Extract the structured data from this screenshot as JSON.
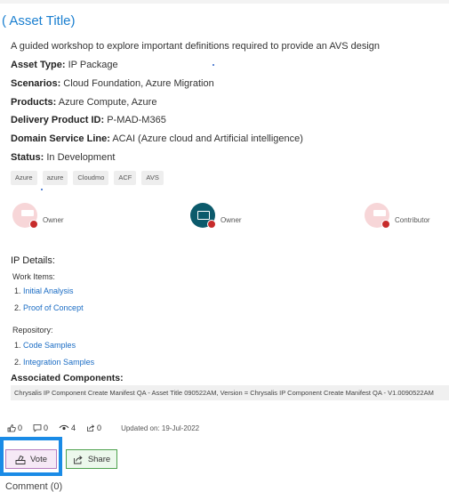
{
  "asset": {
    "title": "( Asset Title)",
    "description": "A guided workshop to explore important definitions required to provide an AVS design"
  },
  "fields": [
    {
      "label": "Asset Type:",
      "value": " IP Package"
    },
    {
      "label": "Scenarios:",
      "value": " Cloud Foundation, Azure Migration"
    },
    {
      "label": "Products:",
      "value": " Azure Compute, Azure"
    },
    {
      "label": "Delivery Product ID:",
      "value": " P-MAD-M365"
    },
    {
      "label": "Domain Service Line:",
      "value": " ACAI (Azure cloud and Artificial intelligence)"
    },
    {
      "label": "Status:",
      "value": " In Development"
    }
  ],
  "tags": [
    "Azure",
    "azure",
    "Cloudmo",
    "ACF",
    "AVS"
  ],
  "people": [
    {
      "name": "",
      "role": "Owner"
    },
    {
      "name": "",
      "role": "Owner"
    },
    {
      "name": "",
      "role": "Contributor"
    }
  ],
  "ip_details": {
    "heading": "IP Details:",
    "work_items_label": "Work Items:",
    "work_items": [
      {
        "num": "1.",
        "label": "Initial Analysis"
      },
      {
        "num": "2.",
        "label": "Proof of Concept"
      }
    ],
    "repository_label": "Repository:",
    "repository": [
      {
        "num": "1.",
        "label": "Code Samples"
      },
      {
        "num": "2.",
        "label": "Integration Samples"
      }
    ],
    "associated_heading": "Associated Components:",
    "associated_value": "Chrysalis IP Component Create Manifest QA - Asset Title 090522AM, Version = Chrysalis IP Component Create Manifest QA - V1.0090522AM"
  },
  "stats": {
    "likes": "0",
    "comments": "0",
    "views": "4",
    "shares": "0",
    "updated": "Updated on: 19-Jul-2022"
  },
  "actions": {
    "vote": "Vote",
    "share": "Share"
  },
  "comments_heading": "Comment (0)",
  "colors": {
    "title": "#1a7fd0",
    "link": "#1a6cc4",
    "highlight": "#1a8be6",
    "vote_bg": "#f6e9f6",
    "share_bg": "#ecf8ec"
  }
}
